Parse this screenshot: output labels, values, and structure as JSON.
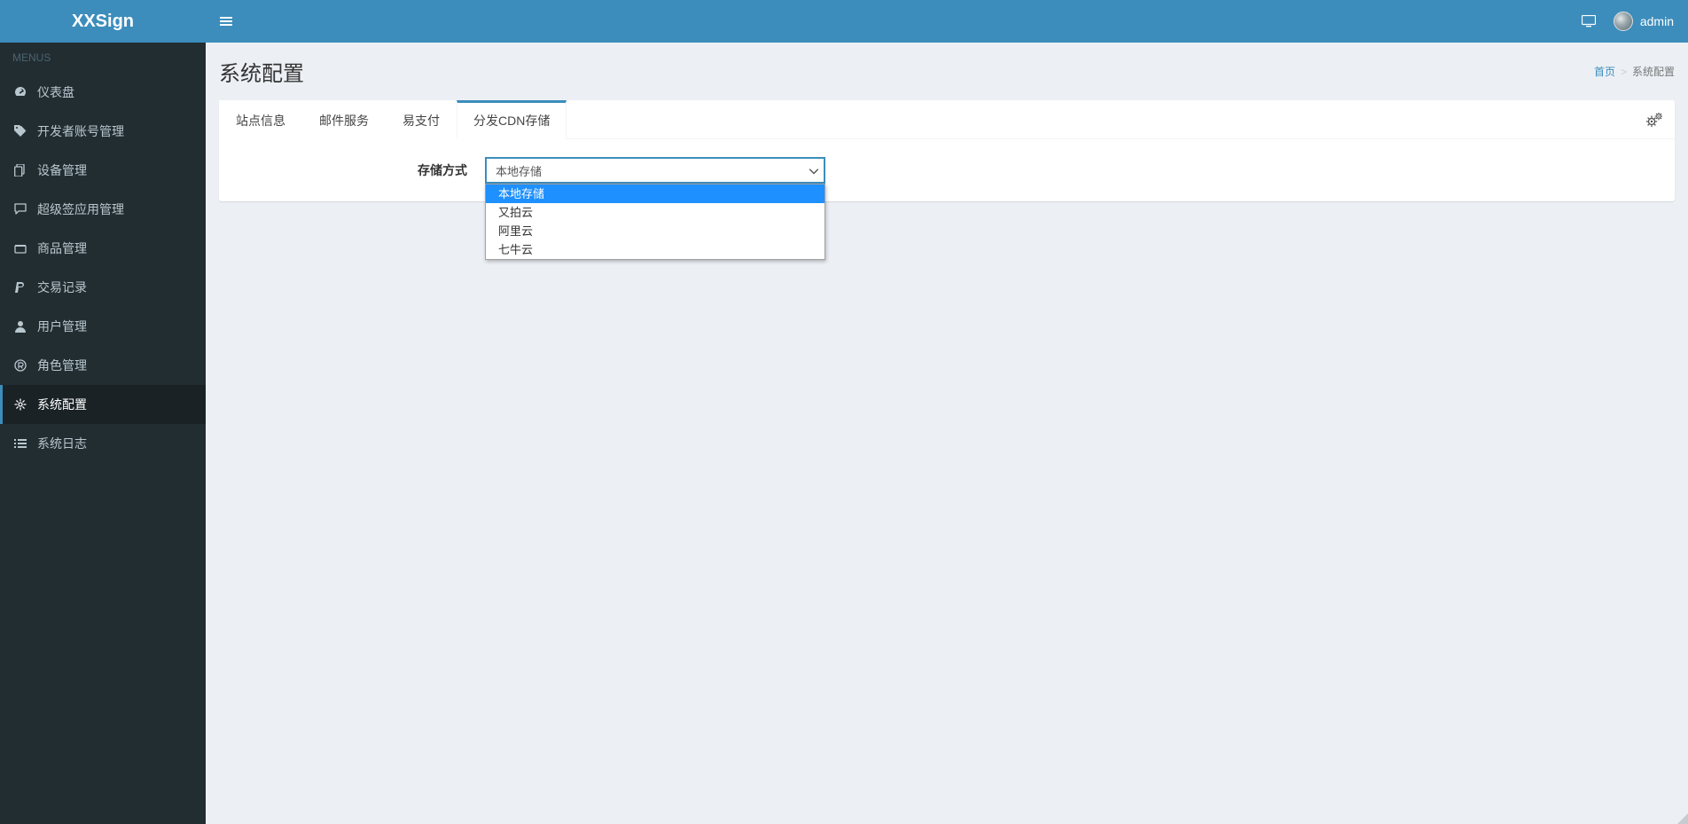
{
  "header": {
    "logo_prefix": "XX",
    "logo_accent": "S",
    "logo_suffix": "ign",
    "user_name": "admin"
  },
  "sidebar": {
    "heading": "MENUS",
    "items": [
      {
        "icon": "dashboard",
        "label": "仪表盘"
      },
      {
        "icon": "tag",
        "label": "开发者账号管理"
      },
      {
        "icon": "copy",
        "label": "设备管理"
      },
      {
        "icon": "comment",
        "label": "超级签应用管理"
      },
      {
        "icon": "cart",
        "label": "商品管理"
      },
      {
        "icon": "paypal",
        "label": "交易记录"
      },
      {
        "icon": "user",
        "label": "用户管理"
      },
      {
        "icon": "registered",
        "label": "角色管理"
      },
      {
        "icon": "gear",
        "label": "系统配置",
        "active": true
      },
      {
        "icon": "list",
        "label": "系统日志"
      }
    ]
  },
  "page": {
    "title": "系统配置",
    "breadcrumb": {
      "home": "首页",
      "current": "系统配置"
    }
  },
  "tabs": [
    {
      "label": "站点信息"
    },
    {
      "label": "邮件服务"
    },
    {
      "label": "易支付"
    },
    {
      "label": "分发CDN存储",
      "active": true
    }
  ],
  "form": {
    "storage_label": "存储方式",
    "storage_selected": "本地存储",
    "storage_options": [
      {
        "label": "本地存储",
        "selected": true
      },
      {
        "label": "又拍云"
      },
      {
        "label": "阿里云"
      },
      {
        "label": "七牛云"
      }
    ]
  }
}
